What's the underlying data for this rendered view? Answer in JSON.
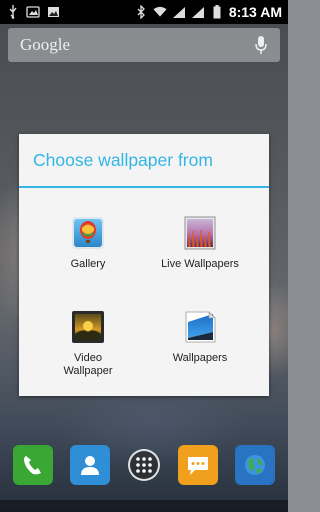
{
  "status_bar": {
    "time": "8:13",
    "time_suffix": "AM"
  },
  "search": {
    "label": "Google"
  },
  "dialog": {
    "title": "Choose wallpaper from",
    "options": [
      {
        "label": "Gallery"
      },
      {
        "label": "Live Wallpapers"
      },
      {
        "label": "Video\nWallpaper"
      },
      {
        "label": "Wallpapers"
      }
    ]
  },
  "colors": {
    "accent": "#33b5e5",
    "dialog_bg": "#f4f4f4"
  },
  "dock": {
    "items": [
      "phone-icon",
      "contacts-icon",
      "apps-icon",
      "messaging-icon",
      "browser-icon"
    ]
  }
}
